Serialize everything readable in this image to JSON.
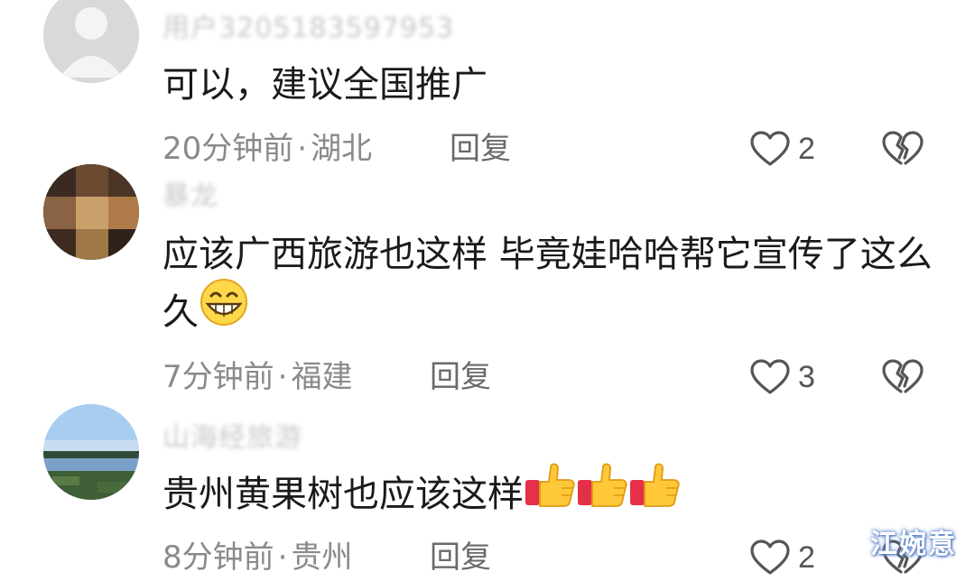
{
  "comments": [
    {
      "username": "用户3205183597953",
      "text": "可以，建议全国推广",
      "time": "20分钟前",
      "location": "湖北",
      "reply_label": "回复",
      "likes": "2"
    },
    {
      "username": "暴龙",
      "text": "应该广西旅游也这样  毕竟娃哈哈帮它宣传了这么久",
      "time": "7分钟前",
      "location": "福建",
      "reply_label": "回复",
      "likes": "3"
    },
    {
      "username": "山海经旅游",
      "text": "贵州黄果树也应该这样",
      "time": "8分钟前",
      "location": "贵州",
      "reply_label": "回复",
      "likes": "2"
    }
  ],
  "meta_separator": "·",
  "watermark": "江婉意",
  "icons": {
    "like": "heart-outline-icon",
    "dislike": "broken-heart-icon",
    "emoji_grin": "grinning-face-emoji",
    "emoji_thumbs": "thumbs-up-emoji"
  }
}
